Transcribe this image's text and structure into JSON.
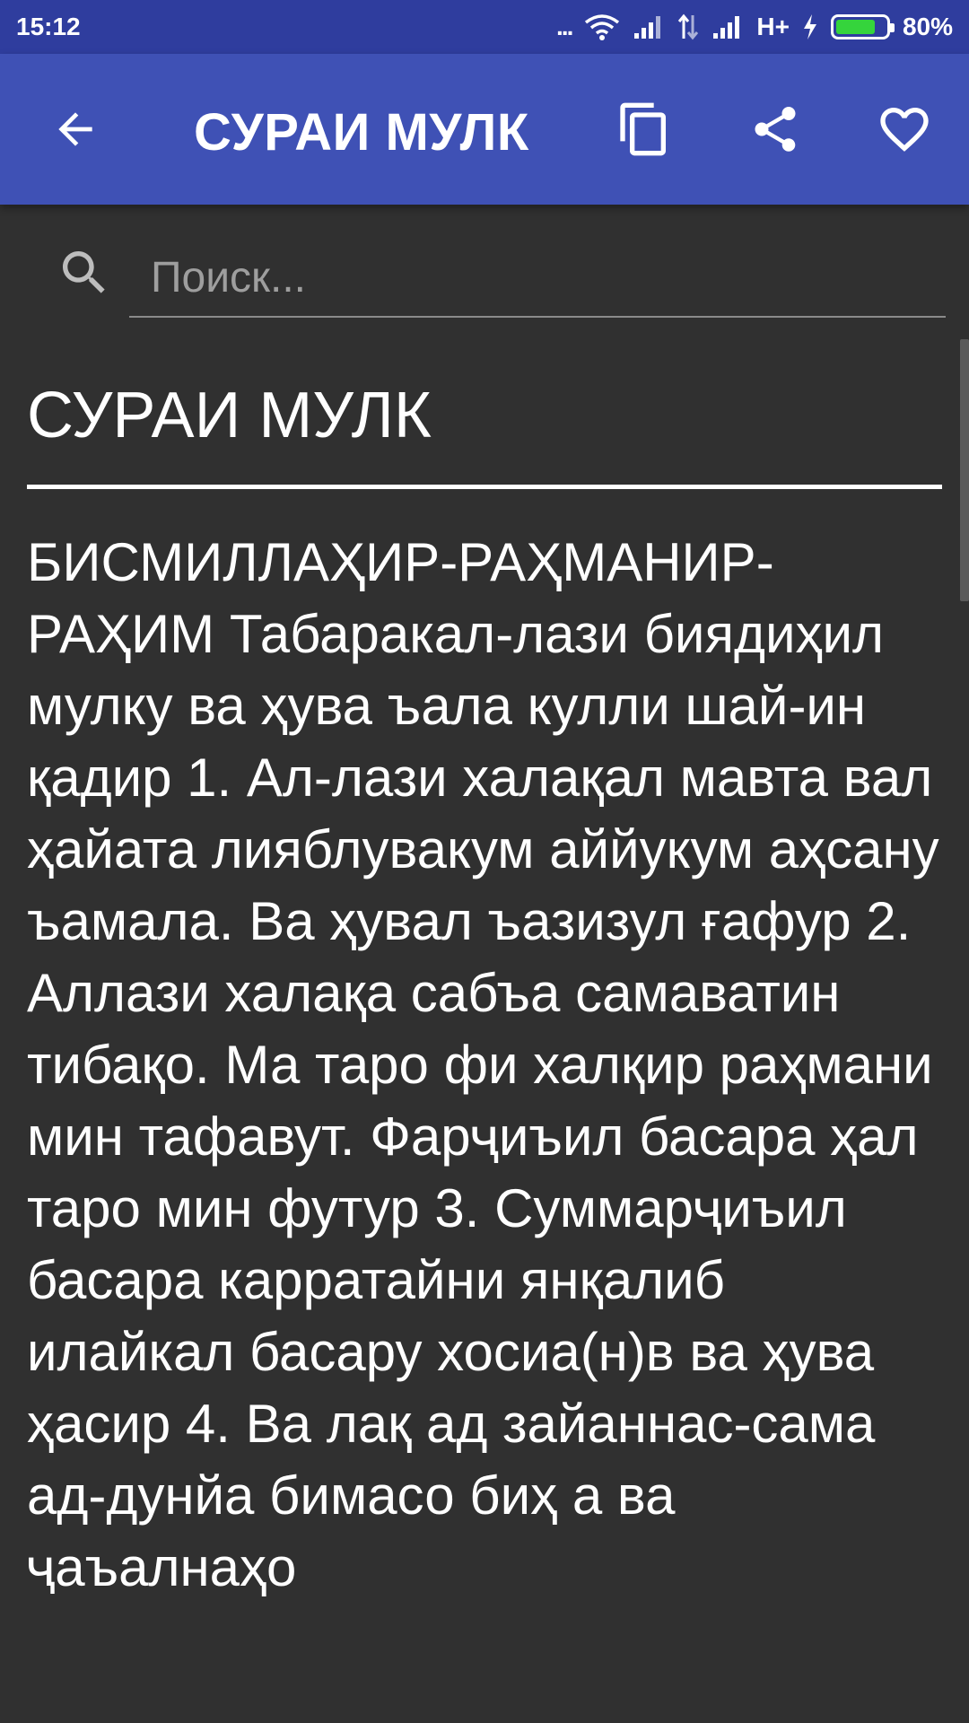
{
  "status_bar": {
    "time": "15:12",
    "dots": "...",
    "network": "H+",
    "battery_percent": "80%",
    "battery_level": 0.8
  },
  "app_bar": {
    "title": "СУРАИ МУЛК"
  },
  "search": {
    "placeholder": "Поиск..."
  },
  "content": {
    "title": "СУРАИ МУЛК",
    "text": "БИСМИЛЛАҲИР-РАҲМАНИР-РАҲИМ Табаракал-лази биядиҳил мулку ва ҳува ъала кулли шай-ин қадир 1. Ал-лази халақал мавта вал ҳайата лияблувакум аййукум аҳсану ъамала. Ва ҳувал ъазизул ғафур 2. Аллази халақа сабъа самаватин тибақо. Ма таро фи халқир раҳмани мин тафавут. Фарҷиъил басара ҳал таро мин футур 3. Суммарҷиъил басара карратайни янқалиб илайкал басару хосиа(н)в ва ҳува ҳасир 4. Ва лақ ад зайаннас-сама ад-дунйа бимасо биҳ а ва ҷаъалнаҳо"
  },
  "colors": {
    "status_bar": "#2f3d9e",
    "app_bar": "#3f51b5",
    "background": "#303030",
    "text": "#ffffff",
    "battery": "#35d43c"
  }
}
